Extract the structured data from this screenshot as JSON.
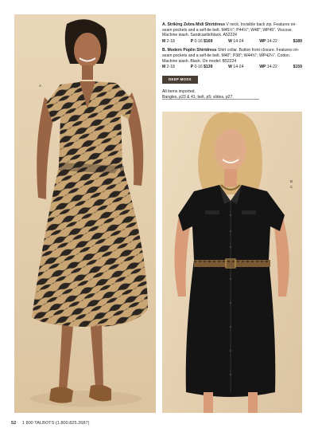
{
  "item_a": {
    "title": "A. Striking Zebra Midi Shirtdress",
    "description": "V neck. Invisible back zip. Features on-seam pockets and a self-tie belt. M45½\"; P44½\"; W48\"; WP45\". Viscose. Machine wash. Sandcastle/black. A52224",
    "sizes": [
      {
        "code": "M",
        "range": "2-18",
        "price": ""
      },
      {
        "code": "P",
        "range": "0-16",
        "price": "$169"
      },
      {
        "code": "W",
        "range": "14-24",
        "price": ""
      },
      {
        "code": "WP",
        "range": "14-22",
        "price": "$189"
      }
    ]
  },
  "item_b": {
    "title": "B. Modern Poplin Shirtdress",
    "description": "Shirt collar. Button front closure. Features on-seam pockets and a self-tie belt. M40\"; P38\"; W44¾\"; WP42¼\". Cotton. Machine wash. Black. On model: B52224",
    "sizes": [
      {
        "code": "M",
        "range": "2-18",
        "price": ""
      },
      {
        "code": "P",
        "range": "0-16",
        "price": "$139"
      },
      {
        "code": "W",
        "range": "14-24",
        "price": ""
      },
      {
        "code": "WP",
        "range": "14-22",
        "price": "$159"
      }
    ]
  },
  "badge": "DEEP MOSS",
  "imported_note": "All items imported.",
  "accessories_note": "Bangles, p23 & 41; belt, p5; slides, p27.",
  "refs": {
    "a": "A",
    "b": "B",
    "c": "C"
  },
  "footer": {
    "page": "52",
    "phone": "1 800 TALBOTS (1.800.825.2687)"
  },
  "colors": {
    "backdrop": "#e4cfae",
    "zebra_base": "#c9a574",
    "zebra_stripe": "#2a2521",
    "black_dress": "#141414",
    "badge": "#4a3f35"
  }
}
